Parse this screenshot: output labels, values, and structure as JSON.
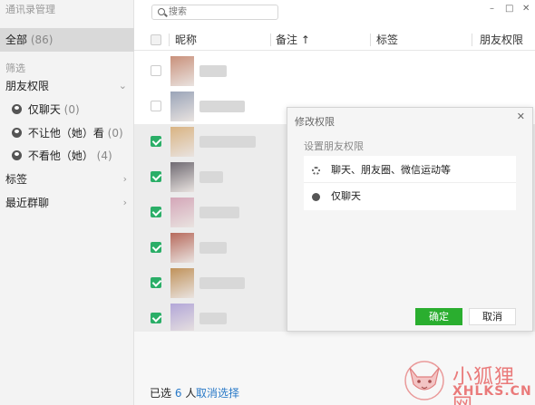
{
  "sidebar": {
    "title": "通讯录管理",
    "all_label": "全部",
    "all_count": "(86)",
    "filter_label": "筛选",
    "friend_perm": {
      "label": "朋友权限",
      "chevron": "chevron-down-icon"
    },
    "perm_items": [
      {
        "label": "仅聊天",
        "count": "(0)"
      },
      {
        "label": "不让他（她）看",
        "count": "(0)"
      },
      {
        "label": "不看他（她）",
        "count": "(4)"
      }
    ],
    "tags": {
      "label": "标签"
    },
    "recent_groups": {
      "label": "最近群聊"
    }
  },
  "search": {
    "placeholder": "搜索"
  },
  "window_controls": [
    "–",
    "□",
    "✕"
  ],
  "table": {
    "headers": {
      "nickname": "昵称",
      "remark": "备注 ↑",
      "tag": "标签",
      "permission": "朋友权限"
    }
  },
  "rows": [
    {
      "checked": false,
      "avatar": "#c9907a"
    },
    {
      "checked": false,
      "avatar": "#9aa4b8"
    },
    {
      "checked": true,
      "avatar": "#d9b382"
    },
    {
      "checked": true,
      "avatar": "#6f6a72"
    },
    {
      "checked": true,
      "avatar": "#d4a6b8"
    },
    {
      "checked": true,
      "avatar": "#b76a5c"
    },
    {
      "checked": true,
      "avatar": "#c0925a"
    },
    {
      "checked": true,
      "avatar": "#b2a6d8"
    }
  ],
  "footer": {
    "selected_prefix": "已选",
    "selected_count": "6",
    "selected_suffix": "人",
    "cancel_select": "取消选择"
  },
  "dialog": {
    "title": "修改权限",
    "subtitle": "设置朋友权限",
    "options": [
      {
        "label": "聊天、朋友圈、微信运动等",
        "icon": "gear-icon"
      },
      {
        "label": "仅聊天",
        "icon": "person-icon"
      }
    ],
    "ok_label": "确定",
    "cancel_label": "取消"
  },
  "watermark": {
    "brand": "小狐狸网",
    "url": "XHLKS.CN"
  },
  "colors": {
    "checkbox_green": "#2aae67",
    "ok_button": "#2aae2f",
    "link_blue": "#2a7ac8",
    "watermark": "#ea7a7a"
  }
}
